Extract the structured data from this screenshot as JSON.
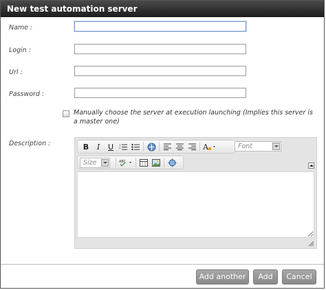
{
  "dialog": {
    "title": "New test automation server"
  },
  "form": {
    "name_label": "Name :",
    "login_label": "Login :",
    "url_label": "Url :",
    "password_label": "Password :",
    "description_label": "Description :",
    "name_value": "",
    "login_value": "",
    "url_value": "",
    "password_value": "",
    "manual_choice_label": "Manually choose the server at execution launching (Implies this server is a master one)",
    "manual_choice_checked": false
  },
  "editor": {
    "font_combo": "Font",
    "size_combo": "Size",
    "toolbar_icons": [
      "bold-icon",
      "italic-icon",
      "underline-icon",
      "ordered-list-icon",
      "bulleted-list-icon",
      "link-icon",
      "align-left-icon",
      "align-center-icon",
      "align-right-icon",
      "text-color-icon",
      "spellcheck-icon",
      "table-icon",
      "image-icon",
      "maximize-icon"
    ]
  },
  "buttons": {
    "add_another": "Add another",
    "add": "Add",
    "cancel": "Cancel"
  }
}
